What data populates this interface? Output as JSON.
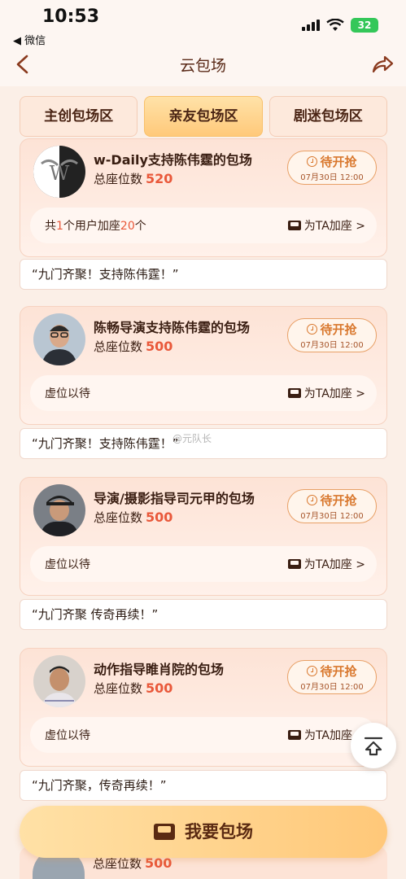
{
  "status_bar": {
    "time": "10:53",
    "back_app": "◀ 微信",
    "battery": "32"
  },
  "nav": {
    "title": "云包场"
  },
  "tabs": [
    {
      "label": "主创包场区",
      "active": false
    },
    {
      "label": "亲友包场区",
      "active": true
    },
    {
      "label": "剧迷包场区",
      "active": false
    }
  ],
  "cards": [
    {
      "title": "w-Daily支持陈伟霆的包场",
      "seat_label": "总座位数",
      "seat_count": "520",
      "status": "待开抢",
      "date": "07月30日 12:00",
      "info_prefix": "共",
      "info_users": "1",
      "info_mid": "个用户加座",
      "info_seats": "20",
      "info_suffix": "个",
      "action": "为TA加座 >",
      "quote": "“九门齐聚！支持陈伟霆！”"
    },
    {
      "title": "陈畅导演支持陈伟霆的包场",
      "seat_label": "总座位数",
      "seat_count": "500",
      "status": "待开抢",
      "date": "07月30日 12:00",
      "info": "虚位以待",
      "action": "为TA加座 >",
      "quote": "“九门齐聚！支持陈伟霆！”"
    },
    {
      "title": "导演/摄影指导司元甲的包场",
      "seat_label": "总座位数",
      "seat_count": "500",
      "status": "待开抢",
      "date": "07月30日 12:00",
      "info": "虚位以待",
      "action": "为TA加座 >",
      "quote": "“九门齐聚 传奇再续！”"
    },
    {
      "title": "动作指导睢肖院的包场",
      "seat_label": "总座位数",
      "seat_count": "500",
      "status": "待开抢",
      "date": "07月30日 12:00",
      "info": "虚位以待",
      "action": "为TA加座",
      "quote": "“九门齐聚，传奇再续！”"
    }
  ],
  "peek_card": {
    "seat_label": "总座位数",
    "seat_count": "500"
  },
  "cta": {
    "label": "我要包场"
  },
  "watermarks": {
    "middle": "@元队长"
  },
  "colors": {
    "accent": "#e9583a",
    "pill": "#d9782e",
    "cta": "#ffc879"
  }
}
